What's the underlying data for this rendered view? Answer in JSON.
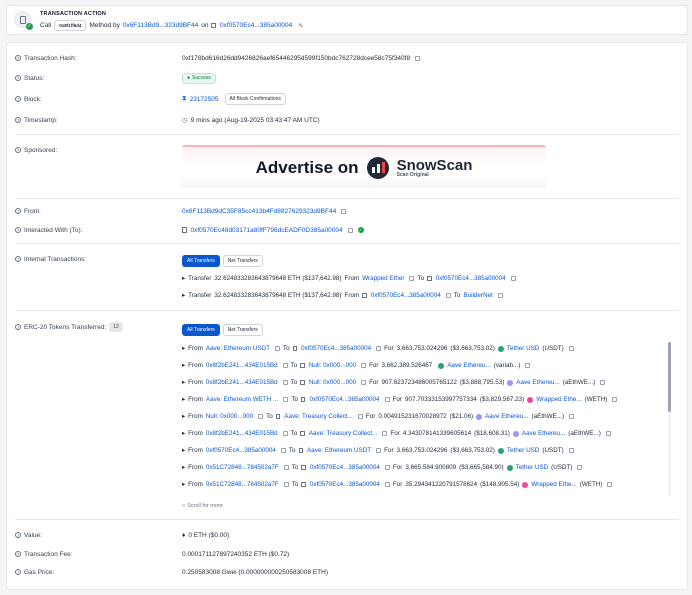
{
  "header": {
    "title": "TRANSACTION ACTION",
    "call_label": "Call",
    "method_badge": "0x8f1ff6d4",
    "method_by": "Method by",
    "from_addr": "0x6F113Bd9...323d9BF44",
    "on_label": "on",
    "to_addr": "0xf0570Ec4...385a00004"
  },
  "details": {
    "tx_hash_label": "Transaction Hash:",
    "tx_hash": "0xf178bd616d26dd9426826aef65446295d599f150bdc762728dcee58c75f340f8",
    "status_label": "Status:",
    "status": "Success",
    "block_label": "Block:",
    "block": "23172505",
    "block_conf": "All Block Confirmations",
    "timestamp_label": "Timestamp:",
    "timestamp": "9 mins ago (Aug-19-2025 03:43:47 AM UTC)",
    "sponsored_label": "Sponsored:",
    "ad_text": "Advertise on",
    "ad_brand": "SnowScan",
    "ad_brand_sub": "Scan Original",
    "from_label": "From:",
    "from": "0x6F113Bd9dC35F85cc413b4Fd8827629323d9BF44",
    "interacted_label": "Interacted With (To):",
    "interacted": "0xf0570Ec48d03171a80fF796dcEADF0D385a00004",
    "internal_label": "Internal Transactions:",
    "tabs": [
      "All Transfers",
      "Net Transfers"
    ],
    "internal": [
      {
        "pre": "Transfer",
        "amount": "32.624833283643879648 ETH ($137,642.98)",
        "from_w": "From",
        "from": "Wrapped Ether",
        "to_w": "To",
        "to": "0xf0570Ec4...385a00004"
      },
      {
        "pre": "Transfer",
        "amount": "32.624833283643879648 ETH ($137,642.98)",
        "from_w": "From",
        "from": "0xf0570Ec4...385a00004",
        "to_w": "To",
        "to": "BuilderNet"
      }
    ],
    "erc20_label": "ERC-20 Tokens Transferred:",
    "erc20_count": "12",
    "erc20": [
      {
        "from": "Aave: Ethereum USDT",
        "to": "0xf0570Ec4...385a00004",
        "for": "3,663,753.024296",
        "usd": "($3,663,753.02)",
        "token": "Tether USD",
        "sym": "(USDT)",
        "color": "#26a17b"
      },
      {
        "from": "0x8f2bE241...434E015Bd",
        "to": "Null: 0x000...000",
        "for": "3,662,389.526467",
        "usd": "",
        "token": "Aave Ethereu...",
        "sym": "(variab...)",
        "color": "#26a17b"
      },
      {
        "from": "0x8f2bE241...434E015Bd",
        "to": "Null: 0x000...000",
        "for": "907.623723486005765122",
        "usd": "($3,888,795.53)",
        "token": "Aave Ethereu...",
        "sym": "(aEthWE...)",
        "color": "#9896ff"
      },
      {
        "from": "Aave: Ethereum WETH ...",
        "to": "0xf0570Ec4...385a00004",
        "for": "907.70333153997757334",
        "usd": "($3,829,567.23)",
        "token": "Wrapped Ethe...",
        "sym": "(WETH)",
        "color": "#ec4899"
      },
      {
        "from": "Null: 0x000...000",
        "to": "Aave: Treasury Collect...",
        "for": "0.004915231670028972",
        "usd": "($21.06)",
        "token": "Aave Ethereu...",
        "sym": "(aEthWE...)",
        "color": "#9896ff"
      },
      {
        "from": "0x8f2bE241...434E015Bd",
        "to": "Aave: Treasury Collect...",
        "for": "4.343078141339605614",
        "usd": "($18,608.31)",
        "token": "Aave Ethereu...",
        "sym": "(aEthWE...)",
        "color": "#9896ff"
      },
      {
        "from": "0xf0570Ec4...385a00004",
        "to": "Aave: Ethereum USDT",
        "for": "3,663,753.024296",
        "usd": "($3,663,753.02)",
        "token": "Tether USD",
        "sym": "(USDT)",
        "color": "#26a17b"
      },
      {
        "from": "0x51C72848...784502a7F",
        "to": "0xf0570Ec4...385a00004",
        "for": "3,665,584.900809",
        "usd": "($3,665,584.90)",
        "token": "Tether USD",
        "sym": "(USDT)",
        "color": "#26a17b"
      },
      {
        "from": "0x51C72848...784502a7F",
        "to": "0xf0570Ec4...385a00004",
        "for": "35.294341220791578624",
        "usd": "($148,905.54)",
        "token": "Wrapped Ethe...",
        "sym": "(WETH)",
        "color": "#ec4899"
      }
    ],
    "from_word": "From",
    "to_word": "To",
    "for_word": "For",
    "scroll_more": "Scroll for more",
    "value_label": "Value:",
    "value": "0 ETH ($0.00)",
    "fee_label": "Transaction Fee:",
    "fee": "0.000171127897240352 ETH ($0.72)",
    "gas_label": "Gas Price:",
    "gas": "0.250583008 Gwei (0.000000000250583008 ETH)"
  }
}
